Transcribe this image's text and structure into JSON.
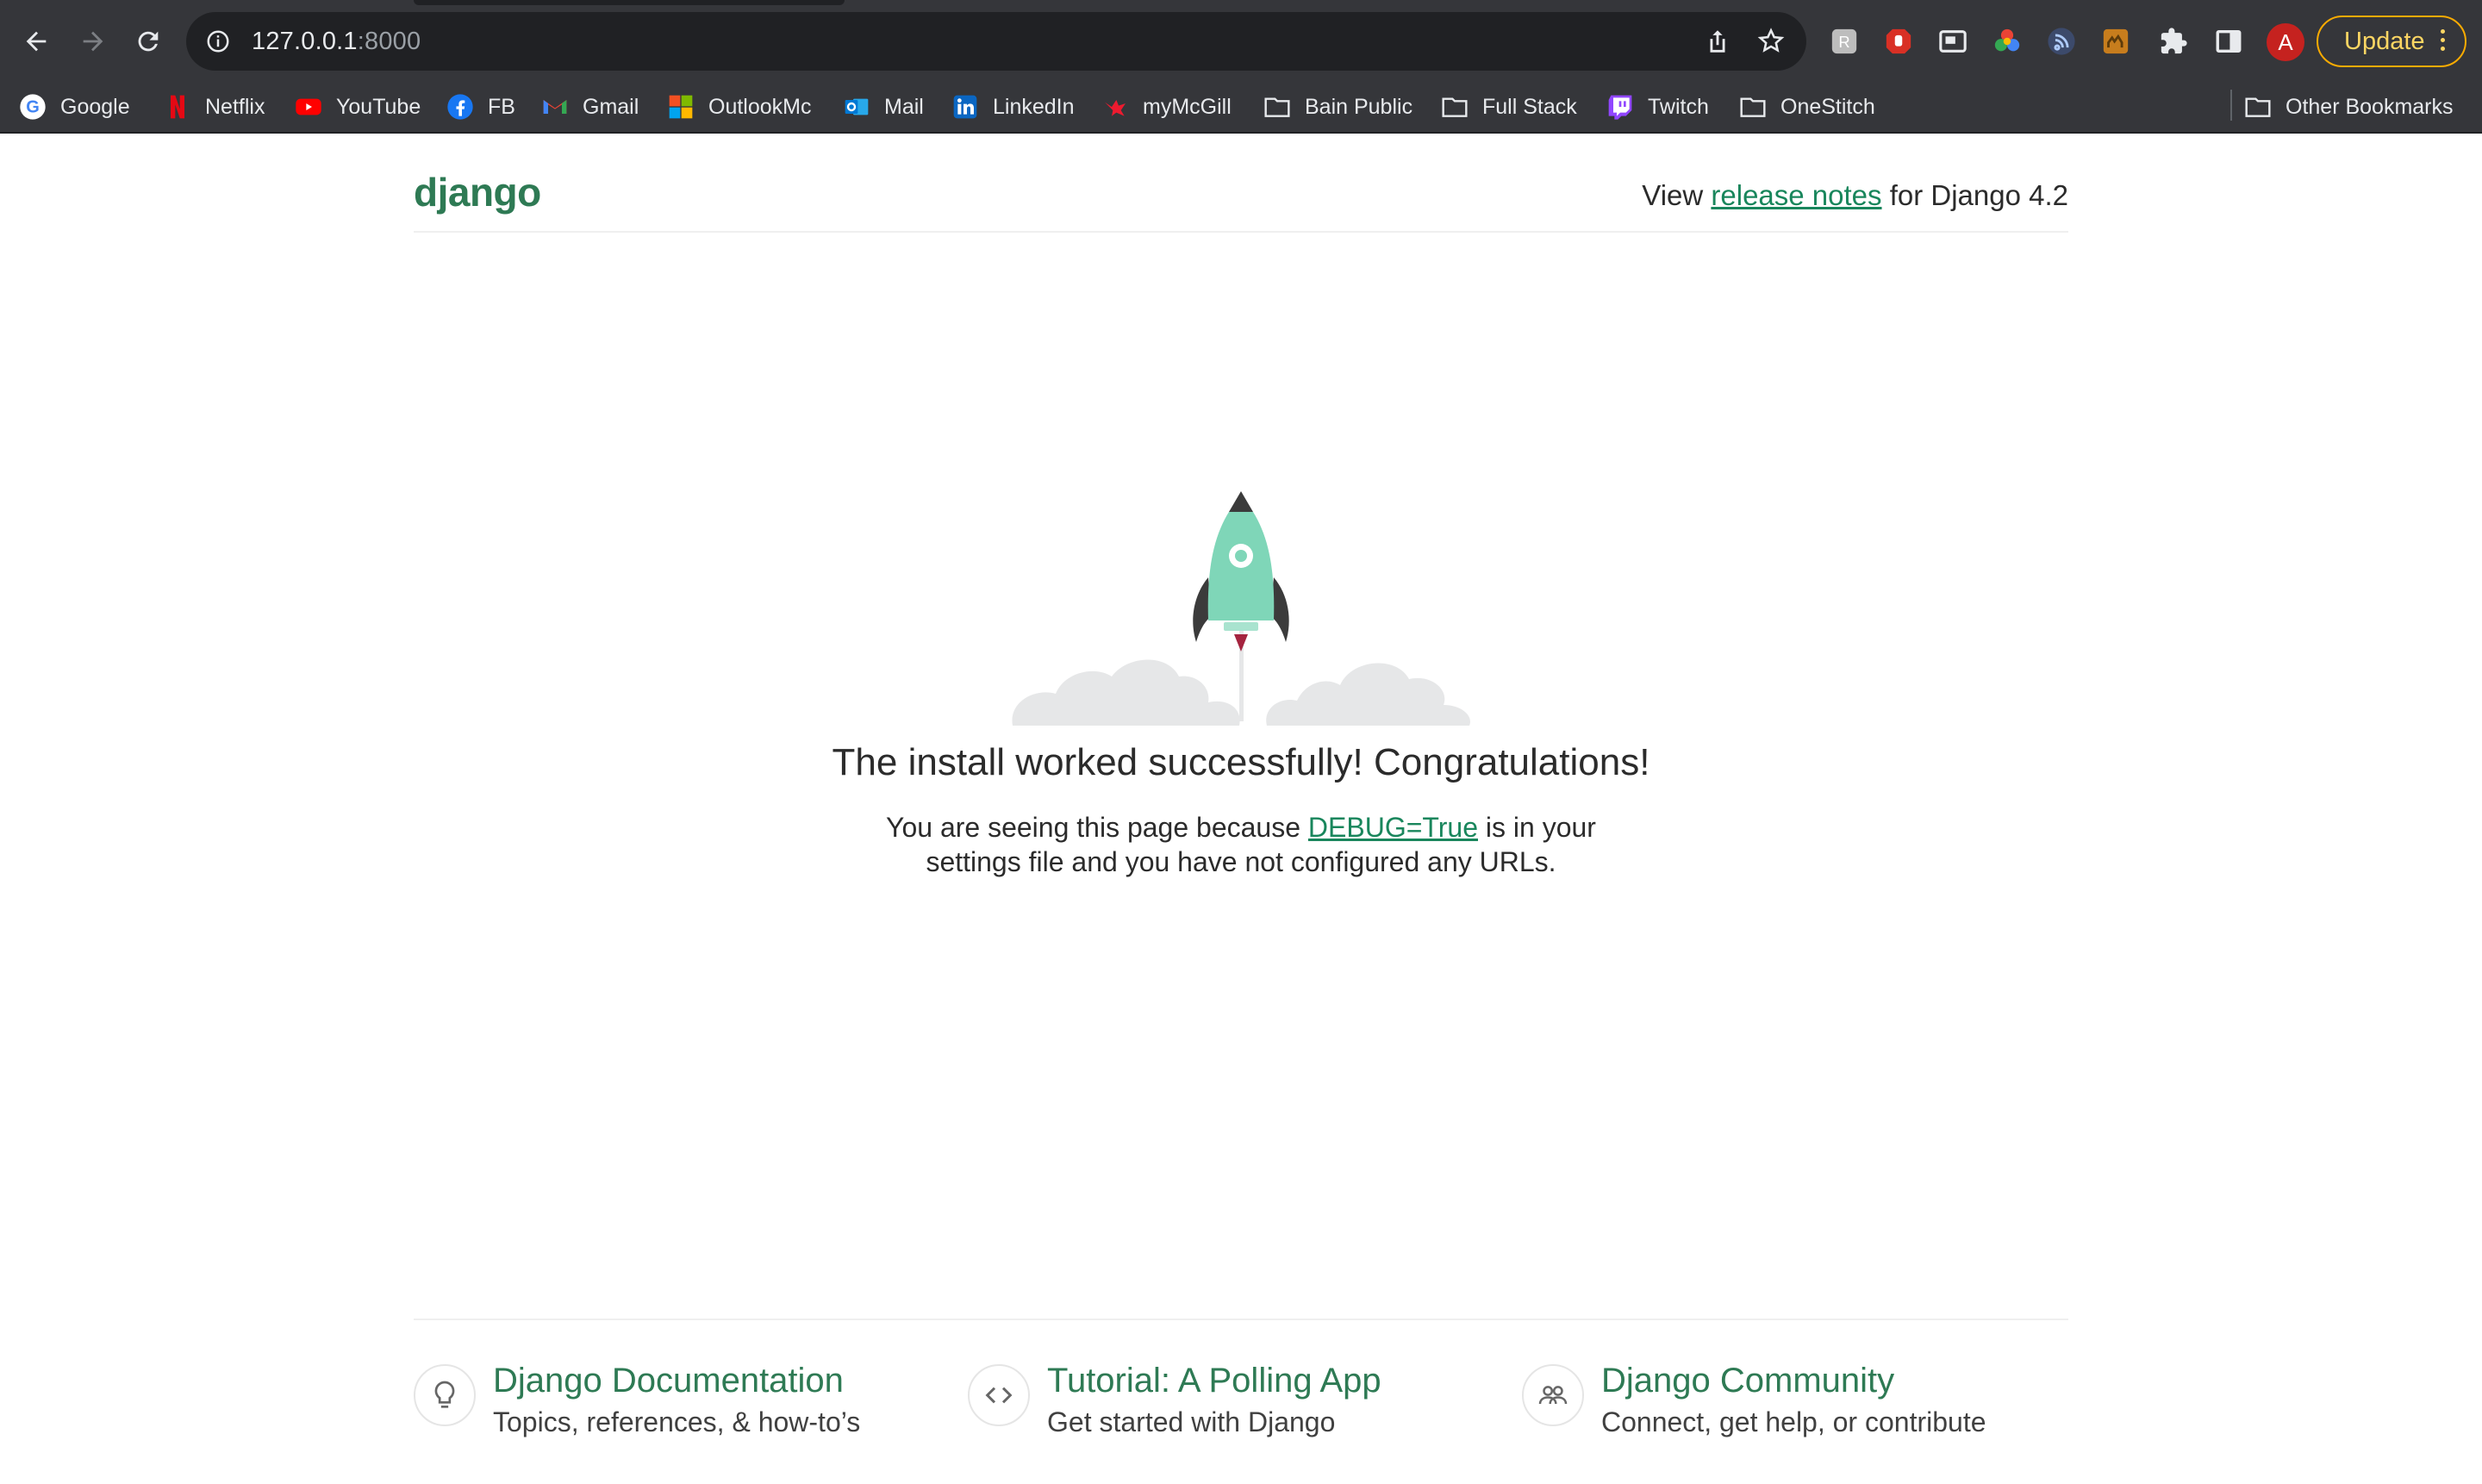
{
  "browser": {
    "url_host": "127.0.0.1",
    "url_port": ":8000",
    "profile_initial": "A",
    "update_label": "Update",
    "bookmarks": [
      {
        "label": "Google",
        "icon": "google-icon"
      },
      {
        "label": "Netflix",
        "icon": "netflix-icon"
      },
      {
        "label": "YouTube",
        "icon": "youtube-icon"
      },
      {
        "label": "FB",
        "icon": "facebook-icon"
      },
      {
        "label": "Gmail",
        "icon": "gmail-icon"
      },
      {
        "label": "OutlookMc",
        "icon": "microsoft-icon"
      },
      {
        "label": "Mail",
        "icon": "outlook-icon"
      },
      {
        "label": "LinkedIn",
        "icon": "linkedin-icon"
      },
      {
        "label": "myMcGill",
        "icon": "mcgill-icon"
      },
      {
        "label": "Bain Public",
        "icon": "folder-icon"
      },
      {
        "label": "Full Stack",
        "icon": "folder-icon"
      },
      {
        "label": "Twitch",
        "icon": "twitch-icon"
      },
      {
        "label": "OneStitch",
        "icon": "folder-icon"
      }
    ],
    "other_bookmarks": "Other Bookmarks"
  },
  "header": {
    "logo": "django",
    "release_prefix": "View ",
    "release_link": "release notes",
    "release_suffix": " for Django 4.2"
  },
  "main": {
    "headline": "The install worked successfully! Congratulations!",
    "sub_prefix": "You are seeing this page because ",
    "sub_link": "DEBUG=True",
    "sub_suffix": " is in your settings file and you have not configured any URLs."
  },
  "footer": [
    {
      "title": "Django Documentation",
      "desc": "Topics, references, & how-to’s",
      "icon": "lightbulb-icon"
    },
    {
      "title": "Tutorial: A Polling App",
      "desc": "Get started with Django",
      "icon": "code-icon"
    },
    {
      "title": "Django Community",
      "desc": "Connect, get help, or contribute",
      "icon": "community-icon"
    }
  ],
  "colors": {
    "brand_green": "#2e7a54",
    "link_green": "#19865c",
    "chrome_dark": "#35363a",
    "rocket": "#7fd6b8"
  }
}
